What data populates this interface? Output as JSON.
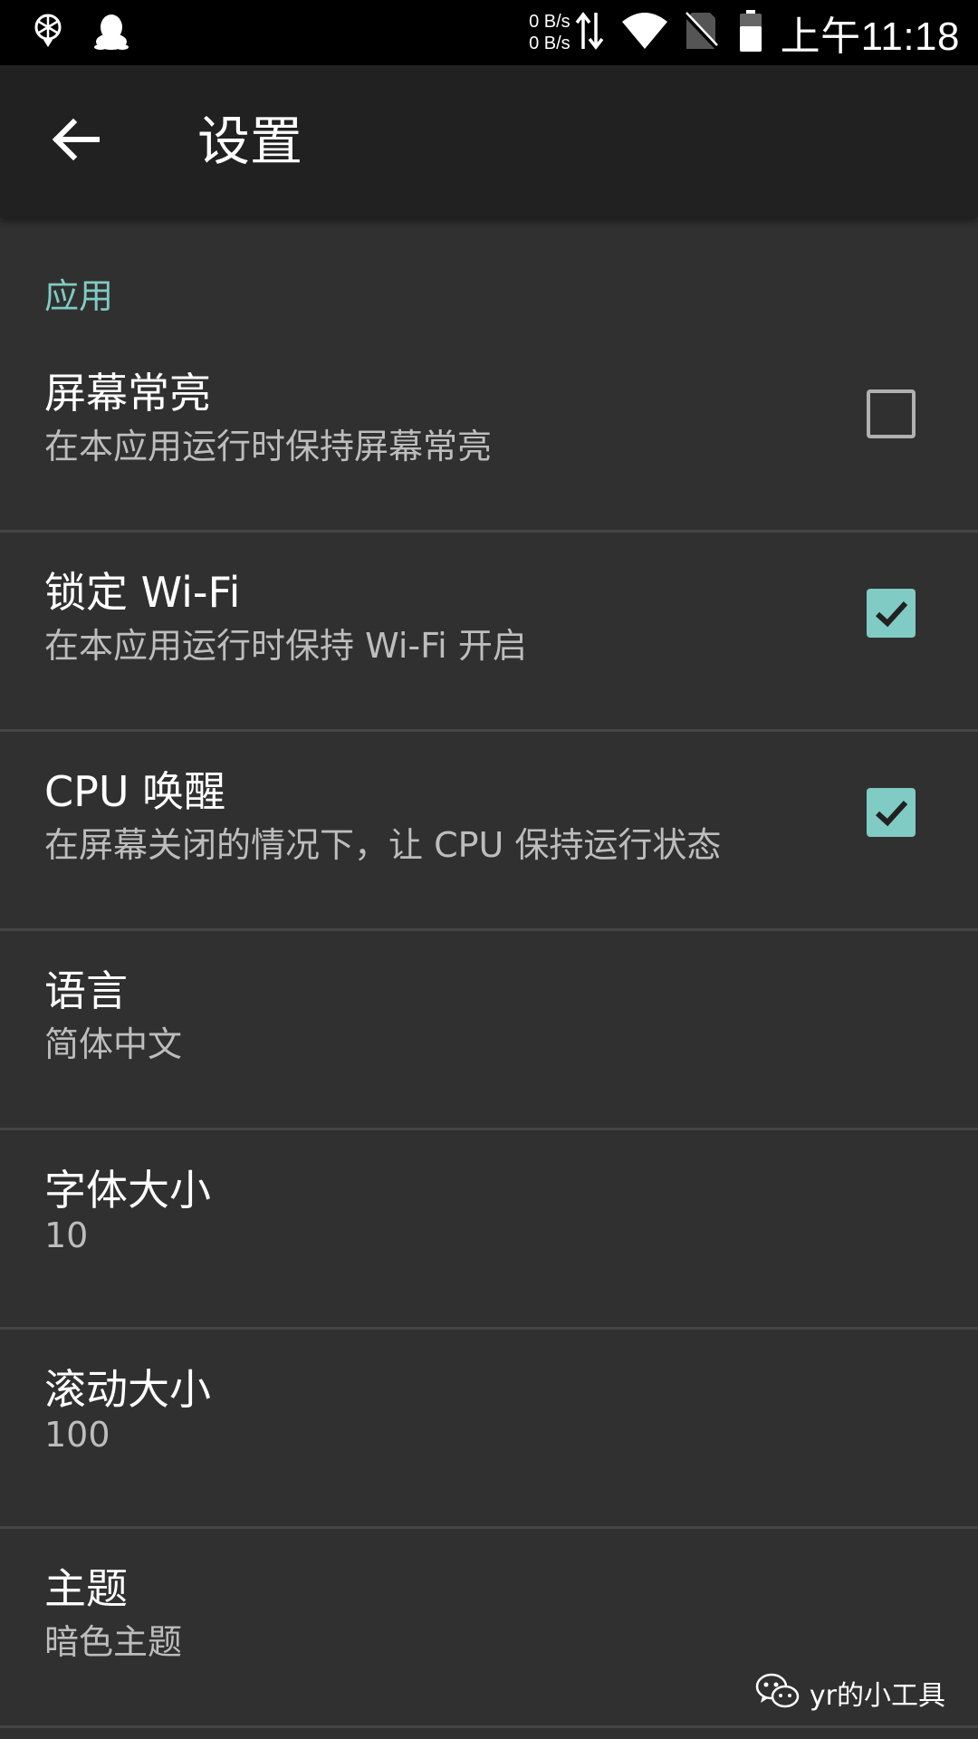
{
  "status_bar": {
    "net_up": "0 B/s",
    "net_down": "0 B/s",
    "time": "上午11:18",
    "icons": [
      "app-notification-icon",
      "qq-icon",
      "data-transfer-icon",
      "wifi-icon",
      "no-sim-icon",
      "battery-icon"
    ]
  },
  "toolbar": {
    "title": "设置",
    "back_icon": "arrow-back-icon"
  },
  "category": {
    "label": "应用"
  },
  "prefs": [
    {
      "title": "屏幕常亮",
      "summary": "在本应用运行时保持屏幕常亮",
      "checked": false
    },
    {
      "title": "锁定 Wi-Fi",
      "summary": "在本应用运行时保持 Wi-Fi 开启",
      "checked": true
    },
    {
      "title": "CPU 唤醒",
      "summary": "在屏幕关闭的情况下，让 CPU 保持运行状态",
      "checked": true
    },
    {
      "title": "语言",
      "summary": "简体中文"
    },
    {
      "title": "字体大小",
      "summary": "10"
    },
    {
      "title": "滚动大小",
      "summary": "100"
    },
    {
      "title": "主题",
      "summary": "暗色主题"
    }
  ],
  "watermark": {
    "text": "yr的小工具",
    "icon": "wechat-icon"
  },
  "colors": {
    "accent": "#80cbc4",
    "background": "#303030",
    "toolbar": "#212121",
    "divider": "#454545"
  }
}
